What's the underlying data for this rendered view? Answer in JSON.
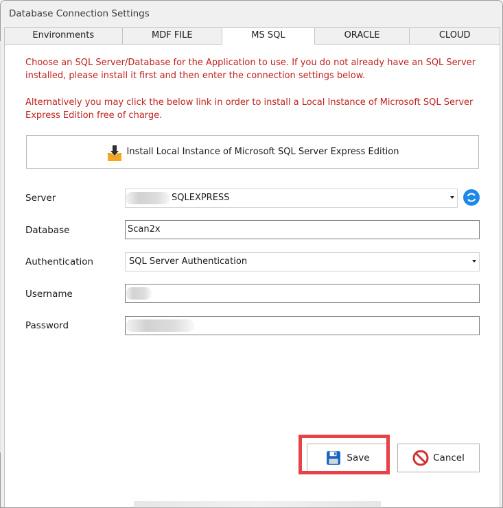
{
  "window": {
    "title": "Database Connection Settings"
  },
  "tabs": [
    {
      "label": "Environments",
      "active": false
    },
    {
      "label": "MDF FILE",
      "active": false
    },
    {
      "label": "MS SQL",
      "active": true
    },
    {
      "label": "ORACLE",
      "active": false
    },
    {
      "label": "CLOUD",
      "active": false
    }
  ],
  "info": {
    "line1": "Choose an SQL Server/Database for the Application to use. If you do not already have an SQL Server installed, please install it first and then enter the connection settings below.",
    "line2": "Alternatively you may click the below link in order to install a Local Instance of Microsoft SQL Server Express Edition free of charge."
  },
  "install_button": {
    "label": "Install Local Instance of Microsoft SQL Server Express Edition",
    "icon": "download-box-icon"
  },
  "form": {
    "server": {
      "label": "Server",
      "value": "SQLEXPRESS",
      "icon": "refresh-icon"
    },
    "database": {
      "label": "Database",
      "value": "Scan2x"
    },
    "authentication": {
      "label": "Authentication",
      "value": "SQL Server Authentication"
    },
    "username": {
      "label": "Username",
      "value": ""
    },
    "password": {
      "label": "Password",
      "value": ""
    }
  },
  "buttons": {
    "save": {
      "label": "Save",
      "icon": "floppy-disk-icon"
    },
    "cancel": {
      "label": "Cancel",
      "icon": "cancel-circle-icon"
    }
  },
  "colors": {
    "info_text": "#c0221f",
    "highlight": "#e8414a",
    "refresh": "#1e88e5",
    "cancel_icon": "#d32f2f",
    "save_icon": "#1565c0"
  }
}
